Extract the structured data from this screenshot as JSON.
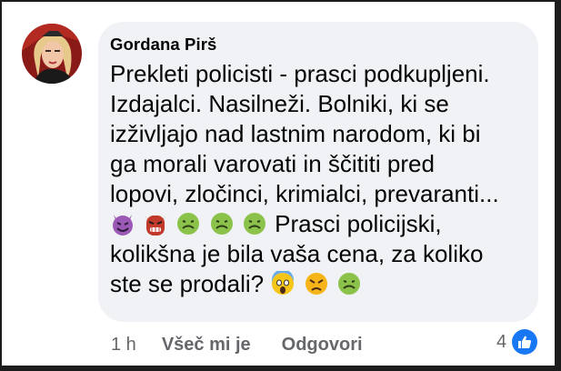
{
  "comment": {
    "author": "Gordana Pirš",
    "lines": [
      "Prekleti policisti - prasci podkupljeni.",
      "Izdajalci. Nasilneži. Bolniki, ki se",
      "izživljajo nad lastnim narodom, ki bi",
      "ga morali varovati in ščititi pred",
      "lopovi, zločinci, krimialci, prevaranti...",
      "Prasci policijski,",
      "kolikšna je bila vaša cena, za koliko",
      "ste se prodali?"
    ],
    "emojis_line6": [
      "smiling-imp",
      "ogre",
      "nauseated-face",
      "nauseated-face",
      "nauseated-face"
    ],
    "emojis_line8": [
      "screaming-face",
      "angry-face",
      "nauseated-face"
    ]
  },
  "actions": {
    "time": "1 h",
    "like_label": "Všeč mi je",
    "reply_label": "Odgovori"
  },
  "reactions": {
    "count": "4",
    "type": "like-icon"
  },
  "colors": {
    "bubble": "#f0f2f5",
    "muted_text": "#65676b",
    "like_blue": "#1877f2"
  }
}
